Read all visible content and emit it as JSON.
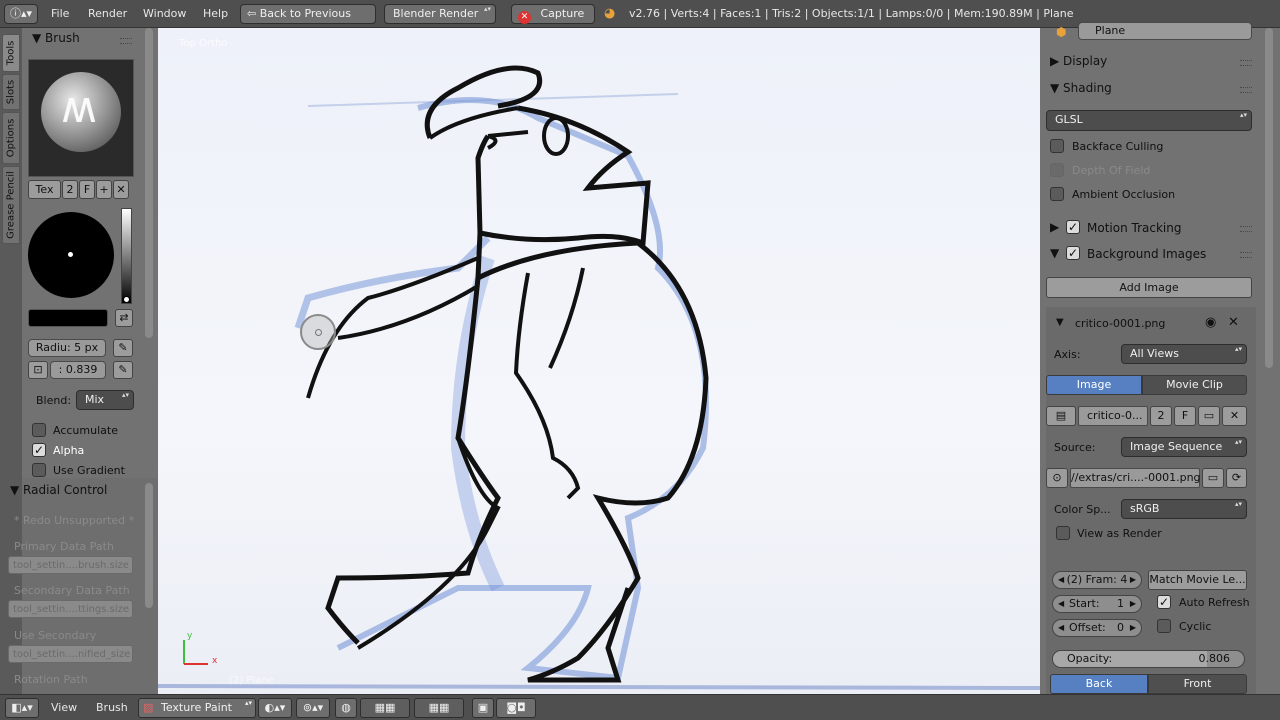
{
  "topbar": {
    "menus": [
      "File",
      "Render",
      "Window",
      "Help"
    ],
    "back_label": "Back to Previous",
    "engine": "Blender Render",
    "capture_label": "Capture",
    "stats": "v2.76 | Verts:4 | Faces:1 | Tris:2 | Objects:1/1 | Lamps:0/0 | Mem:190.89M | Plane"
  },
  "tabs": [
    "Tools",
    "Slots",
    "Options",
    "Grease Pencil"
  ],
  "brush": {
    "header": "Brush",
    "tex_label": "Tex",
    "users": "2",
    "fake": "F",
    "radius": "Radiu: 5 px",
    "strength": ": 0.839",
    "blend_label": "Blend:",
    "blend_value": "Mix",
    "accumulate": "Accumulate",
    "alpha": "Alpha",
    "use_gradient": "Use Gradient"
  },
  "radial": {
    "header": "Radial Control",
    "redo": "* Redo Unsupported *",
    "primary_label": "Primary Data Path",
    "primary_value": "tool_settin....brush.size",
    "secondary_label": "Secondary Data Path",
    "secondary_value": "tool_settin....ttings.size",
    "use_secondary_label": "Use Secondary",
    "use_secondary_value": "tool_settin....nified_size",
    "rotation_label": "Rotation Path"
  },
  "viewport": {
    "view_label": "Top Ortho",
    "object_label": "(2) Plane",
    "axis_y": "y",
    "axis_x": "x"
  },
  "props": {
    "object_name": "Plane",
    "display": "Display",
    "shading": "Shading",
    "shading_mode": "GLSL",
    "backface": "Backface Culling",
    "dof": "Depth Of Field",
    "ambient": "Ambient Occlusion",
    "motion": "Motion Tracking",
    "bgimages": "Background Images",
    "add_image": "Add Image",
    "image_name": "critico-0001.png",
    "axis_label": "Axis:",
    "axis_value": "All Views",
    "image_tab": "Image",
    "movie_tab": "Movie Clip",
    "img_block": "critico-0...",
    "img_users": "2",
    "img_fake": "F",
    "source_label": "Source:",
    "source_value": "Image Sequence",
    "filepath": "//extras/cri....-0001.png",
    "colorspace_label": "Color Sp...",
    "colorspace_value": "sRGB",
    "view_as_render": "View as Render",
    "frames": "(2) Fram: 4",
    "match_movie": "Match Movie Le...",
    "start_label": "Start:",
    "start_value": "1",
    "auto_refresh": "Auto Refresh",
    "offset_label": "Offset:",
    "offset_value": "0",
    "cyclic": "Cyclic",
    "opacity_label": "Opacity:",
    "opacity_value": "0.806",
    "opacity_fraction": 0.806,
    "back_tab": "Back",
    "front_tab": "Front"
  },
  "bottombar": {
    "view": "View",
    "brush": "Brush",
    "mode": "Texture Paint"
  },
  "colors": {
    "accent": "#5680c2",
    "panel": "#727272",
    "header": "#4f4f4f"
  }
}
